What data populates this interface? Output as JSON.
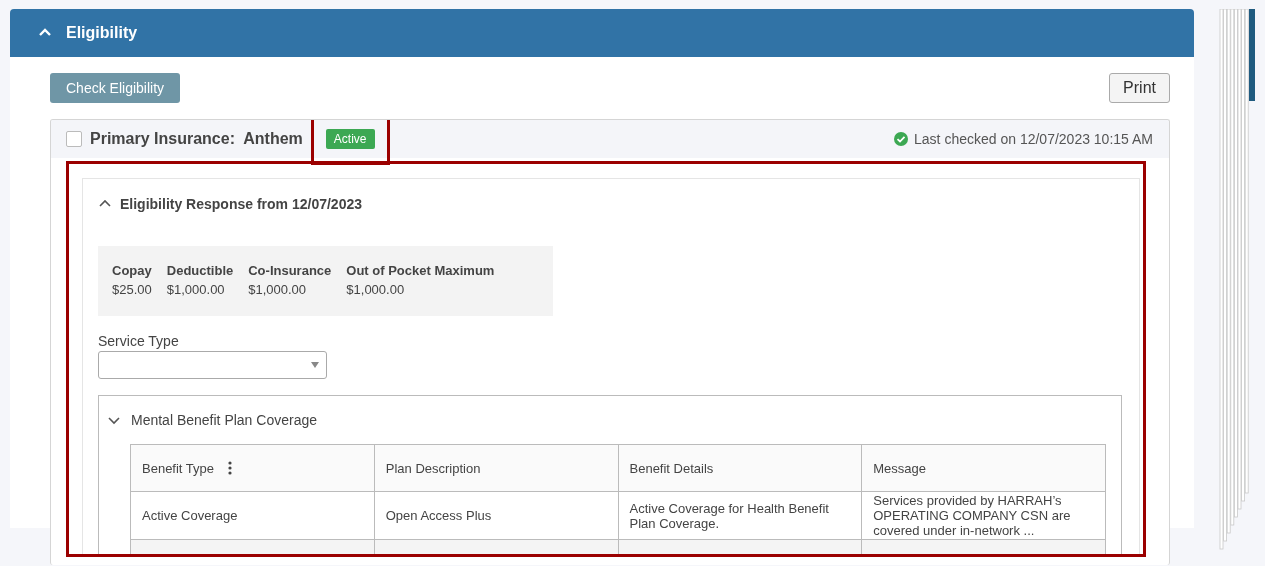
{
  "panel": {
    "title": "Eligibility",
    "expanded": true
  },
  "actions": {
    "check_button": "Check Eligibility",
    "print_button": "Print"
  },
  "insurance": {
    "checked": false,
    "label": "Primary Insurance:",
    "payer": "Anthem",
    "status": "Active",
    "last_checked": "Last checked on 12/07/2023 10:15 AM"
  },
  "response": {
    "title": "Eligibility Response from 12/07/2023",
    "expanded": true,
    "summary": [
      {
        "label": "Copay",
        "value": "$25.00"
      },
      {
        "label": "Deductible",
        "value": "$1,000.00"
      },
      {
        "label": "Co-Insurance",
        "value": "$1,000.00"
      },
      {
        "label": "Out of Pocket Maximum",
        "value": "$1,000.00"
      }
    ],
    "service_type": {
      "label": "Service Type"
    },
    "coverage": {
      "title": "Mental Benefit Plan Coverage",
      "expanded": true,
      "columns": [
        {
          "label": "Benefit Type",
          "menu": true
        },
        {
          "label": "Plan Description",
          "menu": false
        },
        {
          "label": "Benefit Details",
          "menu": false
        },
        {
          "label": "Message",
          "menu": false
        }
      ],
      "rows": [
        [
          "Active Coverage",
          "Open Access Plus",
          "Active Coverage for Health Benefit Plan Coverage.",
          "Services provided by HARRAH’s OPERATING COMPANY CSN are covered under in-network ..."
        ]
      ]
    }
  }
}
